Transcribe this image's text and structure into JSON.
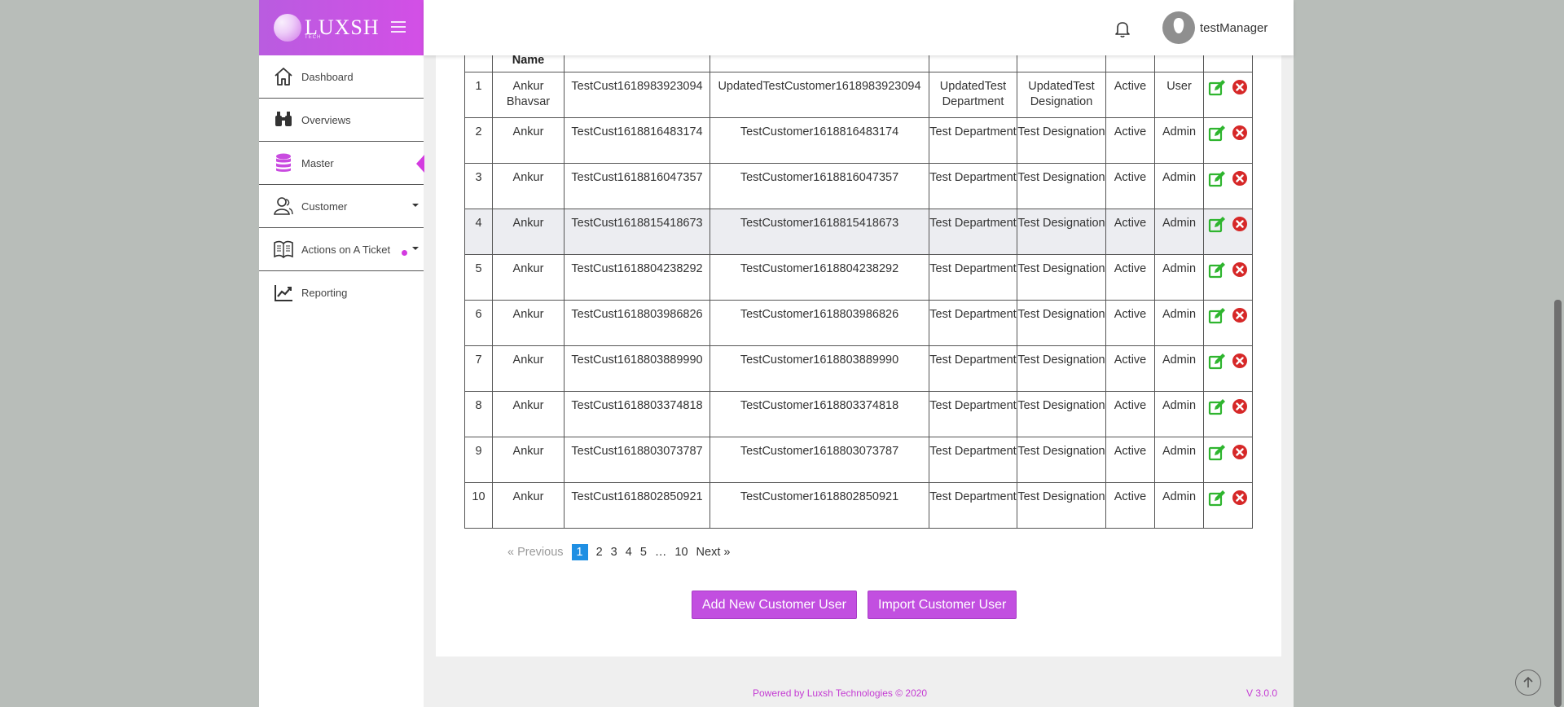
{
  "brand": {
    "name": "LUXSH",
    "tag": "TECH"
  },
  "sidebar": {
    "items": [
      {
        "label": "Dashboard"
      },
      {
        "label": "Overviews"
      },
      {
        "label": "Master"
      },
      {
        "label": "Customer"
      },
      {
        "label": "Actions on A Ticket"
      },
      {
        "label": "Reporting"
      }
    ]
  },
  "header": {
    "username": "testManager"
  },
  "table": {
    "headers": [
      "",
      "Name",
      "",
      "",
      "",
      "",
      "",
      "",
      ""
    ],
    "rows": [
      [
        "1",
        "Ankur Bhavsar",
        "TestCust1618983923094",
        "UpdatedTestCustomer1618983923094",
        "UpdatedTest Department",
        "UpdatedTest Designation",
        "Active",
        "User"
      ],
      [
        "2",
        "Ankur",
        "TestCust1618816483174",
        "TestCustomer1618816483174",
        "Test Department",
        "Test Designation",
        "Active",
        "Admin"
      ],
      [
        "3",
        "Ankur",
        "TestCust1618816047357",
        "TestCustomer1618816047357",
        "Test Department",
        "Test Designation",
        "Active",
        "Admin"
      ],
      [
        "4",
        "Ankur",
        "TestCust1618815418673",
        "TestCustomer1618815418673",
        "Test Department",
        "Test Designation",
        "Active",
        "Admin"
      ],
      [
        "5",
        "Ankur",
        "TestCust1618804238292",
        "TestCustomer1618804238292",
        "Test Department",
        "Test Designation",
        "Active",
        "Admin"
      ],
      [
        "6",
        "Ankur",
        "TestCust1618803986826",
        "TestCustomer1618803986826",
        "Test Department",
        "Test Designation",
        "Active",
        "Admin"
      ],
      [
        "7",
        "Ankur",
        "TestCust1618803889990",
        "TestCustomer1618803889990",
        "Test Department",
        "Test Designation",
        "Active",
        "Admin"
      ],
      [
        "8",
        "Ankur",
        "TestCust1618803374818",
        "TestCustomer1618803374818",
        "Test Department",
        "Test Designation",
        "Active",
        "Admin"
      ],
      [
        "9",
        "Ankur",
        "TestCust1618803073787",
        "TestCustomer1618803073787",
        "Test Department",
        "Test Designation",
        "Active",
        "Admin"
      ],
      [
        "10",
        "Ankur",
        "TestCust1618802850921",
        "TestCustomer1618802850921",
        "Test Department",
        "Test Designation",
        "Active",
        "Admin"
      ]
    ],
    "row_actions": [
      "edit-icon",
      "delete-icon"
    ]
  },
  "pagination": {
    "prev": "« Previous",
    "pages": [
      "1",
      "2",
      "3",
      "4",
      "5"
    ],
    "ellipsis": "…",
    "last": "10",
    "next": "Next »",
    "current": "1"
  },
  "buttons": {
    "add": "Add New Customer User",
    "import": "Import Customer User"
  },
  "footer": {
    "powered": "Powered by Luxsh Technologies © 2020",
    "version": "V 3.0.0"
  },
  "colors": {
    "accent": "#c24fe0",
    "page_active": "#1f8fe3",
    "edit": "#2fb52f",
    "delete": "#d62828"
  }
}
